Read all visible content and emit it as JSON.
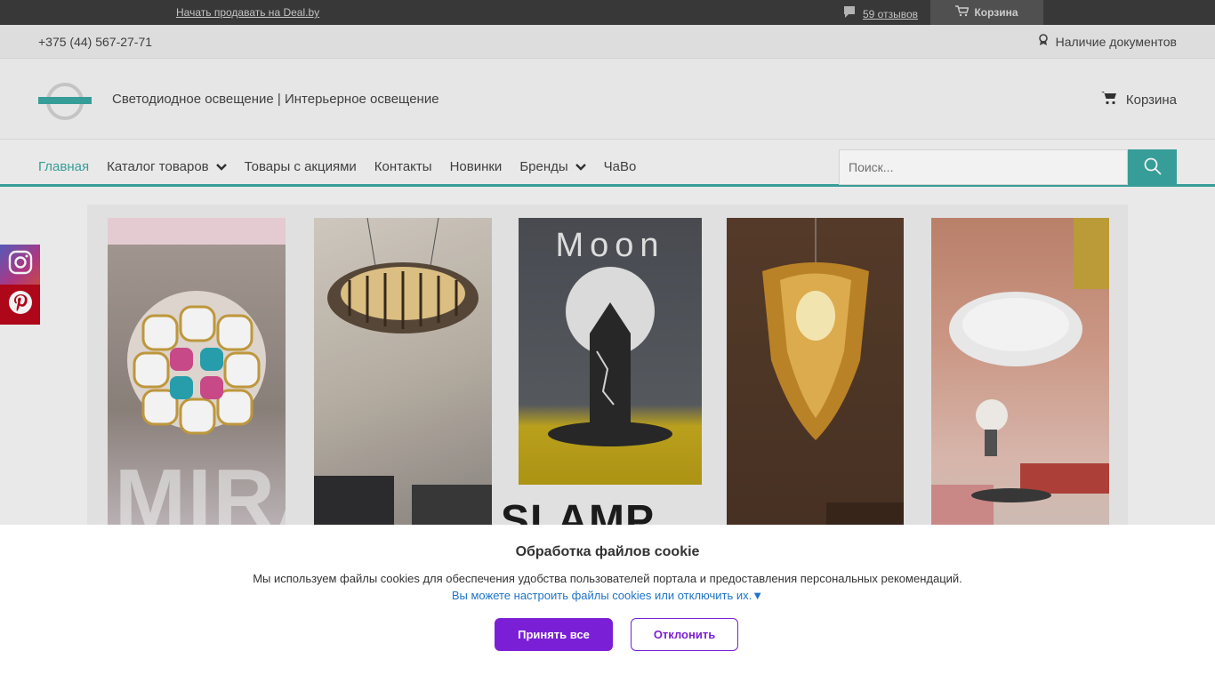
{
  "topbar": {
    "sell_link": "Начать продавать на Deal.by",
    "reviews": "59 отзывов",
    "cart": "Корзина",
    "icons": {
      "reviews": "chat-bubble-icon",
      "cart": "cart-outline-icon"
    }
  },
  "infobar": {
    "phone": "+375 (44) 567-27-71",
    "docs": "Наличие документов",
    "icons": {
      "docs": "badge-icon"
    }
  },
  "header": {
    "tagline": "Светодиодное освещение | Интерьерное освещение",
    "cart": "Корзина",
    "icons": {
      "cart": "cart-icon"
    }
  },
  "nav": {
    "items": [
      {
        "label": "Главная",
        "active": true
      },
      {
        "label": "Каталог товаров",
        "dropdown": true
      },
      {
        "label": "Товары с акциями"
      },
      {
        "label": "Контакты"
      },
      {
        "label": "Новинки"
      },
      {
        "label": "Бренды",
        "dropdown": true
      },
      {
        "label": "ЧаВо"
      }
    ],
    "search_placeholder": "Поиск...",
    "accent_color": "#3aa6a1"
  },
  "social": {
    "icons": [
      "instagram-icon",
      "pinterest-icon"
    ]
  },
  "banner": {
    "texts": {
      "moon": "Moon",
      "mira": "MIRA",
      "slamp": "SLAMP"
    }
  },
  "cookie": {
    "title": "Обработка файлов cookie",
    "message": "Мы используем файлы cookies для обеспечения удобства пользователей портала и предоставления персональных рекомендаций.",
    "settings_link": "Вы можете настроить файлы cookies или отключить их.▼",
    "accept": "Принять все",
    "decline": "Отклонить",
    "button_color": "#7b1fd6",
    "link_color": "#1e74c9"
  }
}
